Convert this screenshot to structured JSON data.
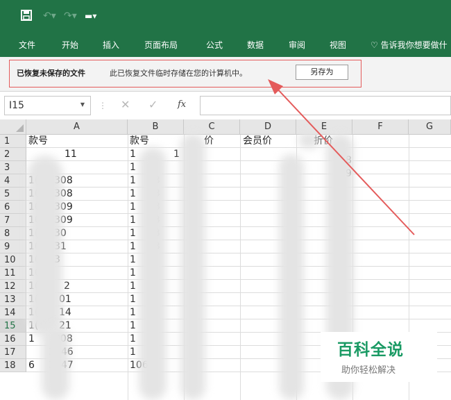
{
  "quick_access": {
    "save_icon": "save-icon",
    "undo_icon": "undo-icon",
    "redo_icon": "redo-icon",
    "customize_icon": "customize-qat-icon"
  },
  "ribbon": {
    "tabs": [
      "文件",
      "开始",
      "插入",
      "页面布局",
      "公式",
      "数据",
      "审阅",
      "视图"
    ],
    "tell_me": "告诉我你想要做什",
    "tell_me_icon": "lightbulb-icon"
  },
  "infobar": {
    "bold_text": "已恢复未保存的文件",
    "message": "此已恢复文件临时存储在您的计算机中。",
    "save_as_label": "另存为",
    "highlight_color": "#e45b5b"
  },
  "formula_bar": {
    "name_box_value": "I15",
    "fx_label": "fx",
    "formula_value": ""
  },
  "grid": {
    "columns": [
      "A",
      "B",
      "C",
      "D",
      "E",
      "F",
      "G"
    ],
    "rows": [
      "1",
      "2",
      "3",
      "4",
      "5",
      "6",
      "7",
      "8",
      "9",
      "10",
      "11",
      "12",
      "13",
      "14",
      "15",
      "16",
      "17",
      "18"
    ],
    "selected_row": "15",
    "header_cells": {
      "a1": "款号",
      "b1": "款号",
      "c1": "价",
      "d1": "会员价",
      "e1": "折价"
    },
    "col_a": [
      "11",
      "",
      "308",
      "308",
      "309",
      "309",
      "30",
      "31",
      "3",
      "",
      "2",
      "01",
      "14",
      "21",
      "008",
      "3046",
      "3047"
    ],
    "col_a_prefix": [
      "",
      "",
      "1(",
      "10",
      "10",
      "10",
      "1(",
      "10",
      "10",
      "10",
      "1(",
      "1(",
      "1(",
      "1(",
      "1",
      "",
      "6"
    ],
    "col_b_prefix": [
      "1",
      "1",
      "1",
      "1",
      "1",
      "1",
      "1",
      "1",
      "1",
      "1",
      "1",
      "1",
      "1",
      "1",
      "1",
      "1",
      "106"
    ],
    "col_b_digit": [
      "1",
      "",
      "3",
      "3",
      "3",
      "3",
      "3",
      "3",
      "",
      "",
      "",
      "",
      "",
      "",
      "",
      "",
      ""
    ],
    "col_e_digits": [
      "8",
      "9"
    ]
  },
  "watermark": {
    "title": "百科全说",
    "subtitle": "助你轻松解决",
    "color": "#1a9a64"
  },
  "colors": {
    "excel_green": "#217346",
    "annotation_red": "#e45b5b"
  }
}
